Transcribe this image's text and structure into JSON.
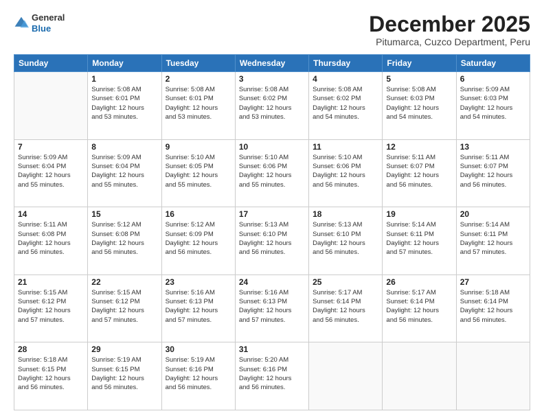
{
  "logo": {
    "line1": "General",
    "line2": "Blue"
  },
  "title": "December 2025",
  "subtitle": "Pitumarca, Cuzco Department, Peru",
  "days_of_week": [
    "Sunday",
    "Monday",
    "Tuesday",
    "Wednesday",
    "Thursday",
    "Friday",
    "Saturday"
  ],
  "weeks": [
    [
      {
        "num": "",
        "detail": ""
      },
      {
        "num": "1",
        "detail": "Sunrise: 5:08 AM\nSunset: 6:01 PM\nDaylight: 12 hours\nand 53 minutes."
      },
      {
        "num": "2",
        "detail": "Sunrise: 5:08 AM\nSunset: 6:01 PM\nDaylight: 12 hours\nand 53 minutes."
      },
      {
        "num": "3",
        "detail": "Sunrise: 5:08 AM\nSunset: 6:02 PM\nDaylight: 12 hours\nand 53 minutes."
      },
      {
        "num": "4",
        "detail": "Sunrise: 5:08 AM\nSunset: 6:02 PM\nDaylight: 12 hours\nand 54 minutes."
      },
      {
        "num": "5",
        "detail": "Sunrise: 5:08 AM\nSunset: 6:03 PM\nDaylight: 12 hours\nand 54 minutes."
      },
      {
        "num": "6",
        "detail": "Sunrise: 5:09 AM\nSunset: 6:03 PM\nDaylight: 12 hours\nand 54 minutes."
      }
    ],
    [
      {
        "num": "7",
        "detail": "Sunrise: 5:09 AM\nSunset: 6:04 PM\nDaylight: 12 hours\nand 55 minutes."
      },
      {
        "num": "8",
        "detail": "Sunrise: 5:09 AM\nSunset: 6:04 PM\nDaylight: 12 hours\nand 55 minutes."
      },
      {
        "num": "9",
        "detail": "Sunrise: 5:10 AM\nSunset: 6:05 PM\nDaylight: 12 hours\nand 55 minutes."
      },
      {
        "num": "10",
        "detail": "Sunrise: 5:10 AM\nSunset: 6:06 PM\nDaylight: 12 hours\nand 55 minutes."
      },
      {
        "num": "11",
        "detail": "Sunrise: 5:10 AM\nSunset: 6:06 PM\nDaylight: 12 hours\nand 56 minutes."
      },
      {
        "num": "12",
        "detail": "Sunrise: 5:11 AM\nSunset: 6:07 PM\nDaylight: 12 hours\nand 56 minutes."
      },
      {
        "num": "13",
        "detail": "Sunrise: 5:11 AM\nSunset: 6:07 PM\nDaylight: 12 hours\nand 56 minutes."
      }
    ],
    [
      {
        "num": "14",
        "detail": "Sunrise: 5:11 AM\nSunset: 6:08 PM\nDaylight: 12 hours\nand 56 minutes."
      },
      {
        "num": "15",
        "detail": "Sunrise: 5:12 AM\nSunset: 6:08 PM\nDaylight: 12 hours\nand 56 minutes."
      },
      {
        "num": "16",
        "detail": "Sunrise: 5:12 AM\nSunset: 6:09 PM\nDaylight: 12 hours\nand 56 minutes."
      },
      {
        "num": "17",
        "detail": "Sunrise: 5:13 AM\nSunset: 6:10 PM\nDaylight: 12 hours\nand 56 minutes."
      },
      {
        "num": "18",
        "detail": "Sunrise: 5:13 AM\nSunset: 6:10 PM\nDaylight: 12 hours\nand 56 minutes."
      },
      {
        "num": "19",
        "detail": "Sunrise: 5:14 AM\nSunset: 6:11 PM\nDaylight: 12 hours\nand 57 minutes."
      },
      {
        "num": "20",
        "detail": "Sunrise: 5:14 AM\nSunset: 6:11 PM\nDaylight: 12 hours\nand 57 minutes."
      }
    ],
    [
      {
        "num": "21",
        "detail": "Sunrise: 5:15 AM\nSunset: 6:12 PM\nDaylight: 12 hours\nand 57 minutes."
      },
      {
        "num": "22",
        "detail": "Sunrise: 5:15 AM\nSunset: 6:12 PM\nDaylight: 12 hours\nand 57 minutes."
      },
      {
        "num": "23",
        "detail": "Sunrise: 5:16 AM\nSunset: 6:13 PM\nDaylight: 12 hours\nand 57 minutes."
      },
      {
        "num": "24",
        "detail": "Sunrise: 5:16 AM\nSunset: 6:13 PM\nDaylight: 12 hours\nand 57 minutes."
      },
      {
        "num": "25",
        "detail": "Sunrise: 5:17 AM\nSunset: 6:14 PM\nDaylight: 12 hours\nand 56 minutes."
      },
      {
        "num": "26",
        "detail": "Sunrise: 5:17 AM\nSunset: 6:14 PM\nDaylight: 12 hours\nand 56 minutes."
      },
      {
        "num": "27",
        "detail": "Sunrise: 5:18 AM\nSunset: 6:14 PM\nDaylight: 12 hours\nand 56 minutes."
      }
    ],
    [
      {
        "num": "28",
        "detail": "Sunrise: 5:18 AM\nSunset: 6:15 PM\nDaylight: 12 hours\nand 56 minutes."
      },
      {
        "num": "29",
        "detail": "Sunrise: 5:19 AM\nSunset: 6:15 PM\nDaylight: 12 hours\nand 56 minutes."
      },
      {
        "num": "30",
        "detail": "Sunrise: 5:19 AM\nSunset: 6:16 PM\nDaylight: 12 hours\nand 56 minutes."
      },
      {
        "num": "31",
        "detail": "Sunrise: 5:20 AM\nSunset: 6:16 PM\nDaylight: 12 hours\nand 56 minutes."
      },
      {
        "num": "",
        "detail": ""
      },
      {
        "num": "",
        "detail": ""
      },
      {
        "num": "",
        "detail": ""
      }
    ]
  ]
}
